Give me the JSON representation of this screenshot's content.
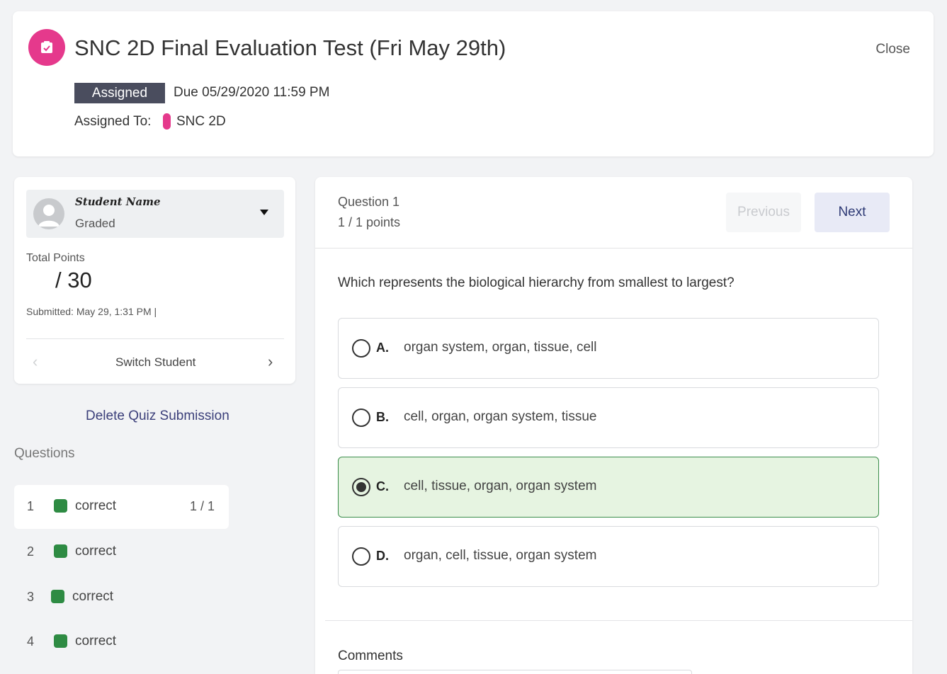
{
  "header": {
    "title": "SNC 2D Final Evaluation Test (Fri May 29th)",
    "close_label": "Close",
    "status_badge": "Assigned",
    "due": "Due 05/29/2020 11:59 PM",
    "assigned_to_label": "Assigned To:",
    "assigned_class": "SNC 2D",
    "accent_color": "#e5398c"
  },
  "student": {
    "name": "Student Name",
    "status": "Graded",
    "total_points_label": "Total Points",
    "total_points_value": "/ 30",
    "submitted": "Submitted: May 29, 1:31 PM |",
    "switch_label": "Switch Student"
  },
  "sidebar": {
    "delete_label": "Delete Quiz Submission",
    "questions_heading": "Questions",
    "questions": [
      {
        "num": "1",
        "status": "correct",
        "score": "1 / 1"
      },
      {
        "num": "2",
        "status": "correct",
        "score": ""
      },
      {
        "num": "3",
        "status": "correct",
        "score": ""
      },
      {
        "num": "4",
        "status": "correct",
        "score": ""
      }
    ],
    "correct_color": "#2e8b43"
  },
  "question": {
    "title": "Question 1",
    "points": "1 / 1 points",
    "prev_label": "Previous",
    "next_label": "Next",
    "text": "Which represents the biological hierarchy from smallest to largest?",
    "options": [
      {
        "letter": "A.",
        "text": "organ system, organ, tissue, cell"
      },
      {
        "letter": "B.",
        "text": "cell, organ, organ system, tissue"
      },
      {
        "letter": "C.",
        "text": "cell, tissue, organ, organ system"
      },
      {
        "letter": "D.",
        "text": "organ, cell, tissue, organ system"
      }
    ],
    "selected_option": "C.",
    "comments_label": "Comments"
  },
  "icons": [
    "assignment-icon",
    "avatar-icon",
    "chevron-down-icon",
    "chevron-left-icon",
    "chevron-right-icon",
    "radio-icon"
  ]
}
